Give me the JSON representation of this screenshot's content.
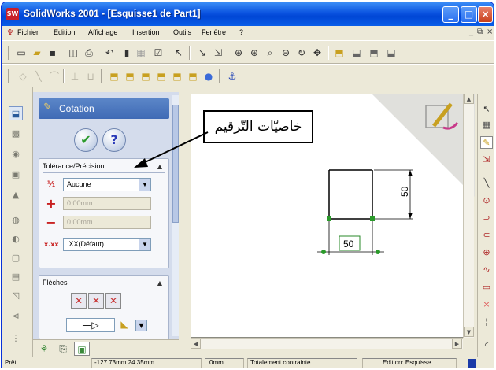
{
  "window": {
    "app_icon": "SW",
    "title": "SolidWorks 2001 - [Esquisse1 de Part1]",
    "controls": {
      "minimize": "_",
      "maximize": "□",
      "close": "×"
    }
  },
  "menubar": {
    "items": [
      "Fichier",
      "Edition",
      "Affichage",
      "Insertion",
      "Outils",
      "Fenêtre",
      "?"
    ],
    "mdi": {
      "minimize": "_",
      "restore": "⧉",
      "close": "×"
    }
  },
  "property_manager": {
    "title": "Cotation",
    "ok_label": "✔",
    "help_label": "?",
    "tolerance_group": {
      "header": "Tolérance/Précision",
      "collapse": "▲",
      "tolerance_type": "Aucune",
      "upper_value": "0,00mm",
      "lower_value": "0,00mm",
      "precision": ".XX(Défaut)"
    },
    "arrows_group": {
      "header": "Flèches",
      "collapse": "▲"
    }
  },
  "drawing": {
    "dimension_vertical": "50",
    "dimension_horizontal": "50"
  },
  "callout": {
    "text": "خاصيّات التّرقيم"
  },
  "statusbar": {
    "state": "Prêt",
    "coordinates": "-127.73mm 24.35mm",
    "z": "0mm",
    "constraint": "Totalement contrainte",
    "mode": "Edition: Esquisse"
  },
  "icons": {
    "toolbar1": [
      "new-icon",
      "open-icon",
      "save-icon",
      "print-preview-icon",
      "print-icon",
      "undo-icon",
      "rebuild-icon",
      "grid-icon",
      "options-icon",
      "help-pointer-icon",
      "sketch-icon",
      "smart-dimension-icon",
      "zoom-fit-icon",
      "zoom-in-icon",
      "zoom-area-icon",
      "zoom-out-icon",
      "rotate-icon",
      "pan-icon",
      "view-front-icon",
      "view-back-icon",
      "view-left-icon",
      "view-right-icon"
    ],
    "toolbar2": [
      "view-orient-icon",
      "line-icon",
      "arc-icon",
      "dim-horizontal-icon",
      "dim-vertical-icon",
      "view-iso-icon",
      "view-top-icon",
      "view-bottom-icon",
      "view-trimetric-icon",
      "view-dimetric-icon",
      "view-normal-icon",
      "sphere-icon",
      "section-icon"
    ],
    "accent": "#0a53e0",
    "callout_border": "#000000"
  }
}
